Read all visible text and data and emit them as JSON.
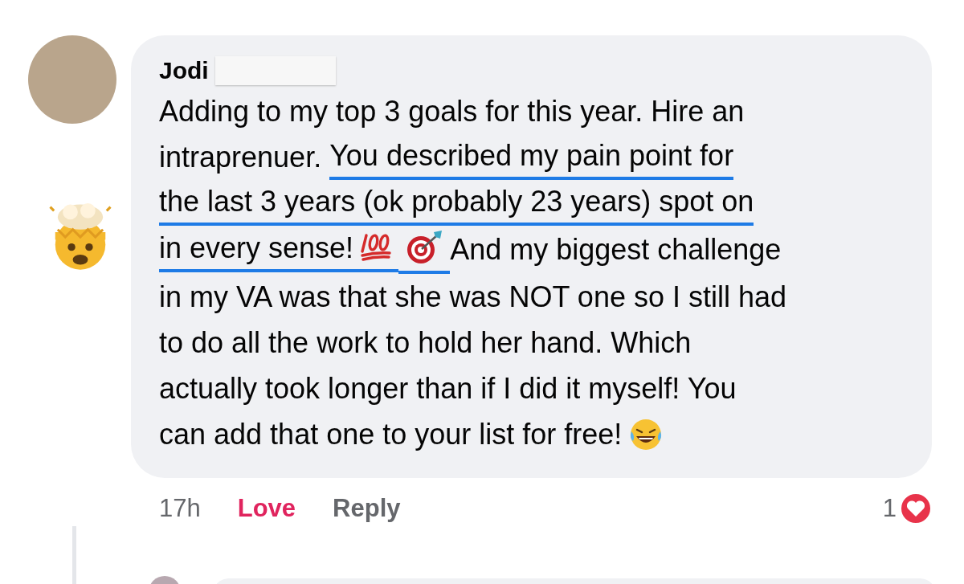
{
  "comment": {
    "author": "Jodi",
    "author_redacted": true,
    "lines": [
      [
        {
          "kind": "text",
          "text": "Adding to my top 3 goals for this year. Hire an",
          "underlined": false
        }
      ],
      [
        {
          "kind": "text",
          "text": "intraprenuer. ",
          "underlined": false
        },
        {
          "kind": "text",
          "text": "You described my pain point for",
          "underlined": true
        }
      ],
      [
        {
          "kind": "text",
          "text": "the last 3 years (ok probably 23 years) spot on",
          "underlined": true
        }
      ],
      [
        {
          "kind": "text",
          "text": "in every sense!",
          "underlined": true
        },
        {
          "kind": "hundred",
          "underlined": true
        },
        {
          "kind": "target",
          "underlined": true
        },
        {
          "kind": "text",
          "text": "And my biggest challenge",
          "underlined": false
        }
      ],
      [
        {
          "kind": "text",
          "text": "in my VA was that she was NOT one so I still had",
          "underlined": false
        }
      ],
      [
        {
          "kind": "text",
          "text": "to do all the work to hold her hand. Which",
          "underlined": false
        }
      ],
      [
        {
          "kind": "text",
          "text": "actually took longer than if I did it myself! You",
          "underlined": false
        }
      ],
      [
        {
          "kind": "text",
          "text": "can add that one to your list for free!",
          "underlined": false
        },
        {
          "kind": "laughing",
          "underlined": false
        }
      ]
    ],
    "side_reaction": {
      "kind": "mind_blown"
    },
    "time": "17h",
    "reaction_button": {
      "label": "Love",
      "active": true
    },
    "reply_button": {
      "label": "Reply"
    },
    "reaction_count": "1"
  }
}
